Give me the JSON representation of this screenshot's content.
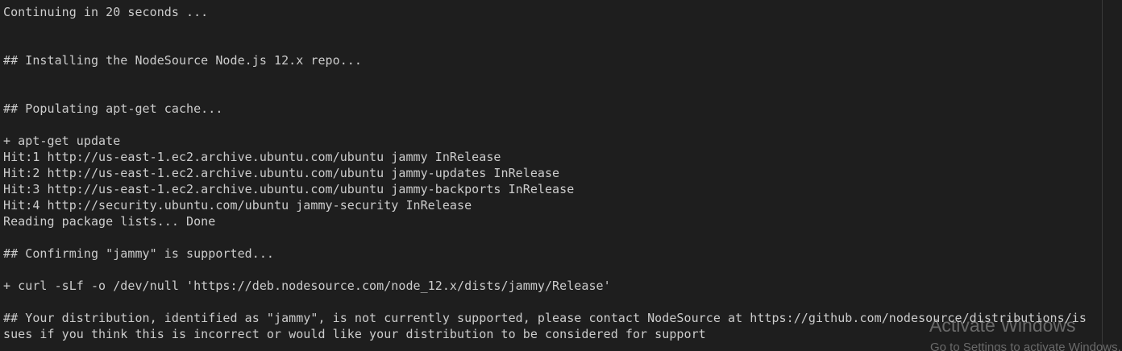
{
  "terminal": {
    "lines": [
      "Continuing in 20 seconds ...",
      "",
      "",
      "## Installing the NodeSource Node.js 12.x repo...",
      "",
      "",
      "## Populating apt-get cache...",
      "",
      "+ apt-get update",
      "Hit:1 http://us-east-1.ec2.archive.ubuntu.com/ubuntu jammy InRelease",
      "Hit:2 http://us-east-1.ec2.archive.ubuntu.com/ubuntu jammy-updates InRelease",
      "Hit:3 http://us-east-1.ec2.archive.ubuntu.com/ubuntu jammy-backports InRelease",
      "Hit:4 http://security.ubuntu.com/ubuntu jammy-security InRelease",
      "Reading package lists... Done",
      "",
      "## Confirming \"jammy\" is supported...",
      "",
      "+ curl -sLf -o /dev/null 'https://deb.nodesource.com/node_12.x/dists/jammy/Release'",
      "",
      "## Your distribution, identified as \"jammy\", is not currently supported, please contact NodeSource at https://github.com/nodesource/distributions/is",
      "sues if you think this is incorrect or would like your distribution to be considered for support"
    ]
  },
  "watermark": {
    "title": "Activate Windows",
    "subtitle": "Go to Settings to activate Windows."
  },
  "colors": {
    "background": "#1e1e1e",
    "text": "#cccccc"
  }
}
